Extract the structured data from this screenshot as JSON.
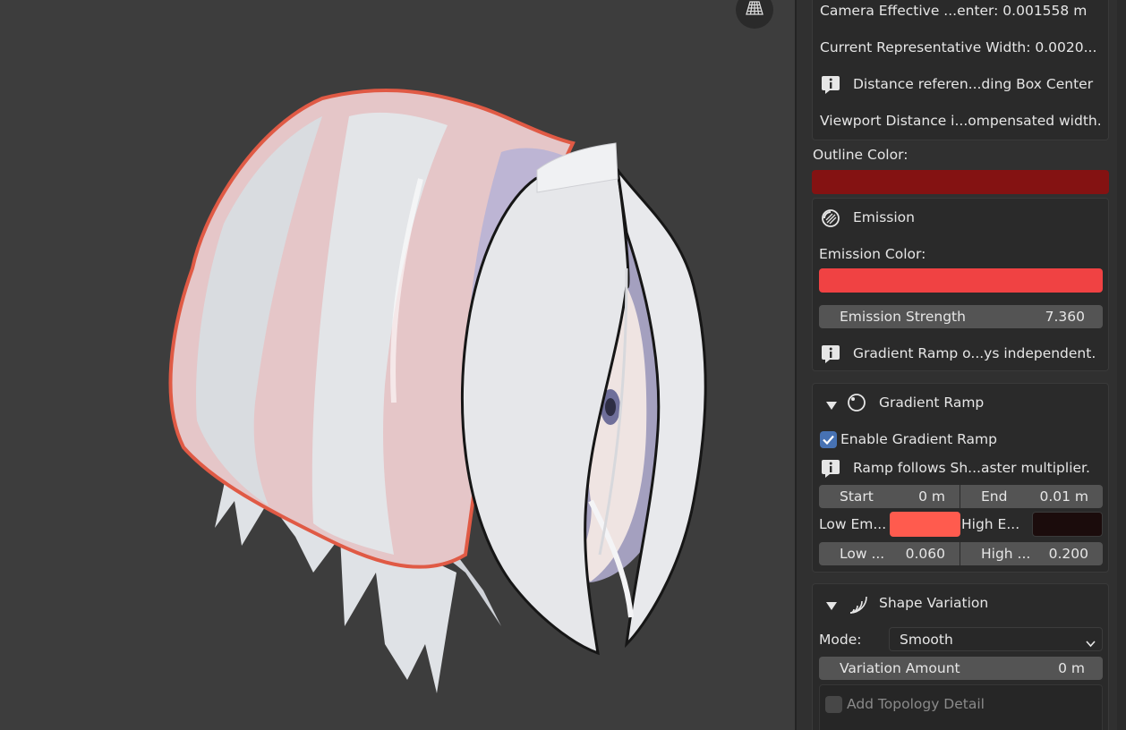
{
  "viewport": {
    "gizmo_icon": "grid-perspective-icon"
  },
  "panel": {
    "info_rows": [
      {
        "text": "Camera Effective ...enter: 0.001558 m"
      },
      {
        "text": "Current Representative Width: 0.0020..."
      },
      {
        "text": "Distance referen...ding Box Center",
        "icon": "info-icon"
      },
      {
        "text": "Viewport Distance i...ompensated width."
      }
    ],
    "outline": {
      "label": "Outline Color:",
      "color": "#841212"
    },
    "emission": {
      "title": "Emission",
      "icon": "emission-icon",
      "color_label": "Emission Color:",
      "color": "#f04243",
      "strength_label": "Emission Strength",
      "strength_value": "7.360",
      "info": "Gradient Ramp o...ys independent."
    },
    "gradient_ramp": {
      "title": "Gradient Ramp",
      "icon": "ramp-icon",
      "enable_label": "Enable Gradient Ramp",
      "enabled": true,
      "info": "Ramp follows Sh...aster multiplier.",
      "start_label": "Start",
      "start_value": "0 m",
      "end_label": "End",
      "end_value": "0.01 m",
      "low_em_label": "Low Em...",
      "low_em_color": "#ff5b4e",
      "high_e_label": "High E...",
      "high_e_color": "#1b0c0c",
      "low_label": "Low ...",
      "low_value": "0.060",
      "high_label": "High ...",
      "high_value": "0.200"
    },
    "shape_variation": {
      "title": "Shape Variation",
      "icon": "wave-icon",
      "mode_label": "Mode:",
      "mode_value": "Smooth",
      "variation_label": "Variation Amount",
      "variation_value": "0 m",
      "topology_label": "Add Topology Detail"
    }
  }
}
